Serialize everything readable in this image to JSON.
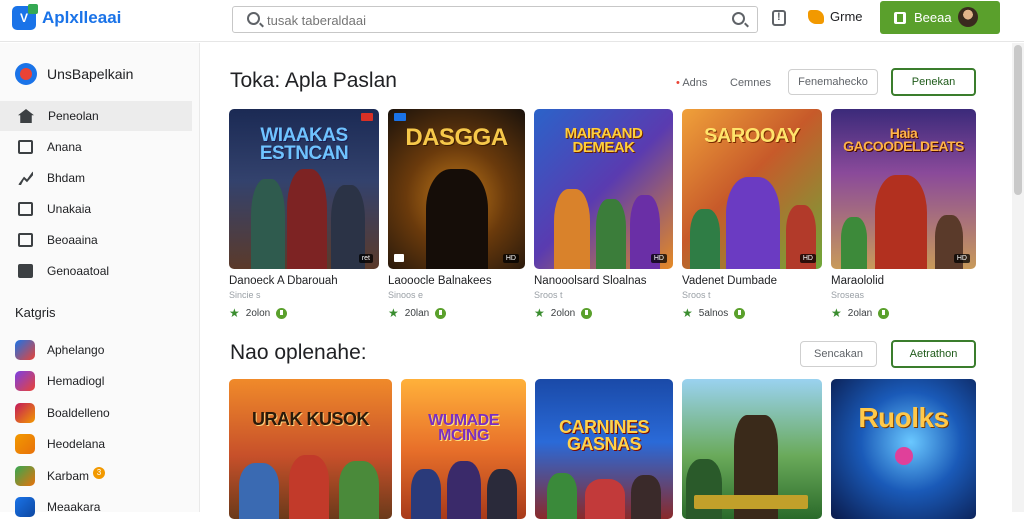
{
  "app": {
    "title": "Aplxlleaai"
  },
  "search": {
    "placeholder": "tusak taberaldaai"
  },
  "header": {
    "game_label": "Grme",
    "account_label": "Beeaa"
  },
  "sidebar": {
    "heading": "UnsBapelkain",
    "nav": [
      {
        "label": "Peneolan",
        "icon": "home-icon",
        "active": true
      },
      {
        "label": "Anana",
        "icon": "grid-icon"
      },
      {
        "label": "Bhdam",
        "icon": "arrow-icon"
      },
      {
        "label": "Unakaia",
        "icon": "library-icon"
      },
      {
        "label": "Beoaaina",
        "icon": "book-icon"
      },
      {
        "label": "Genoaatoal",
        "icon": "folder-icon"
      }
    ],
    "categories_title": "Katgris",
    "categories": [
      {
        "label": "Aphelango",
        "color": "#ea4335"
      },
      {
        "label": "Hemadiogl",
        "color": "#7b3fe4"
      },
      {
        "label": "Boaldelleno",
        "color": "#c2185b"
      },
      {
        "label": "Heodelana",
        "color": "#f29900"
      },
      {
        "label": "Karbam",
        "color": "#e8710a",
        "badge": "3"
      },
      {
        "label": "Meaakara",
        "color": "#1a73e8"
      }
    ]
  },
  "section1": {
    "title": "Toka: Apla Paslan",
    "link1": "Adns",
    "link2": "Cemnes",
    "btn_outline": "Fenemahecko",
    "btn_green": "Penekan",
    "cards": [
      {
        "title": "Danoeck A Dbarouah",
        "sub": "Sincie s",
        "rating": "2olon",
        "art_text": "WIAAKAS ESTNCAN",
        "badge": "ret"
      },
      {
        "title": "Laooocle Balnakees",
        "sub": "Sinoos e",
        "rating": "20lan",
        "art_text": "DASGGA",
        "badge": "HD"
      },
      {
        "title": "Nanooolsard Sloalnas",
        "sub": "Sroos t",
        "rating": "2olon",
        "art_text": "MAIRAAND DEMEAK",
        "badge": "HD"
      },
      {
        "title": "Vadenet Dumbade",
        "sub": "Sroos t",
        "rating": "5alnos",
        "art_text": "SAROOAY",
        "badge": "HD"
      },
      {
        "title": "Maraololid",
        "sub": "Sroseas",
        "rating": "2olan",
        "art_text": "Haia GACOODELDEATS",
        "badge": "HD"
      }
    ]
  },
  "section2": {
    "title": "Nao oplenahe:",
    "btn_outline": "Sencakan",
    "btn_green": "Aetrathon",
    "cards": [
      {
        "art_text": "URAK KUSOK"
      },
      {
        "art_text": "WUMADE MCING"
      },
      {
        "art_text": "CARNINES GASNAS"
      },
      {
        "art_text": ""
      },
      {
        "art_text": "Ruolks"
      }
    ]
  }
}
